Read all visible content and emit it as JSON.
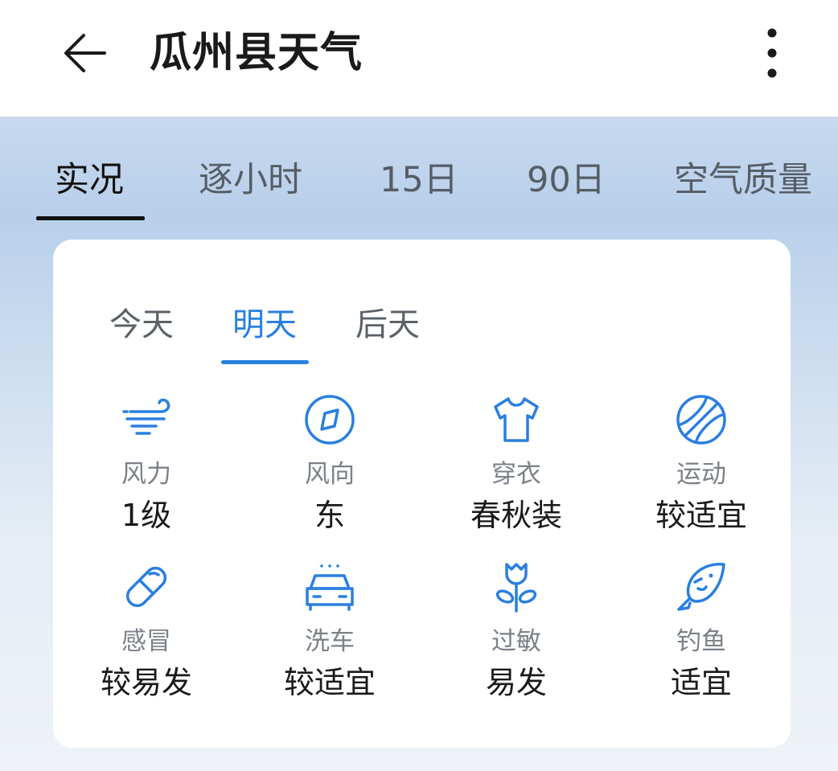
{
  "header": {
    "title": "瓜州县天气",
    "back_icon": "arrow-left-icon",
    "more_icon": "more-vertical-icon"
  },
  "main_tabs": [
    {
      "label": "实况",
      "active": true
    },
    {
      "label": "逐小时",
      "active": false
    },
    {
      "label": "15日",
      "active": false
    },
    {
      "label": "90日",
      "active": false
    },
    {
      "label": "空气质量",
      "active": false
    }
  ],
  "day_tabs": [
    {
      "label": "今天",
      "active": false
    },
    {
      "label": "明天",
      "active": true
    },
    {
      "label": "后天",
      "active": false
    }
  ],
  "indices": [
    {
      "icon": "wind-icon",
      "label": "风力",
      "value": "1级"
    },
    {
      "icon": "compass-icon",
      "label": "风向",
      "value": "东"
    },
    {
      "icon": "tshirt-icon",
      "label": "穿衣",
      "value": "春秋装"
    },
    {
      "icon": "ball-icon",
      "label": "运动",
      "value": "较适宜"
    },
    {
      "icon": "pill-icon",
      "label": "感冒",
      "value": "较易发"
    },
    {
      "icon": "car-wash-icon",
      "label": "洗车",
      "value": "较适宜"
    },
    {
      "icon": "flower-icon",
      "label": "过敏",
      "value": "易发"
    },
    {
      "icon": "fish-icon",
      "label": "钓鱼",
      "value": "适宜"
    }
  ],
  "colors": {
    "accent": "#2a7fe0",
    "text_primary": "#1a1a1a",
    "text_secondary": "#7b8189"
  }
}
